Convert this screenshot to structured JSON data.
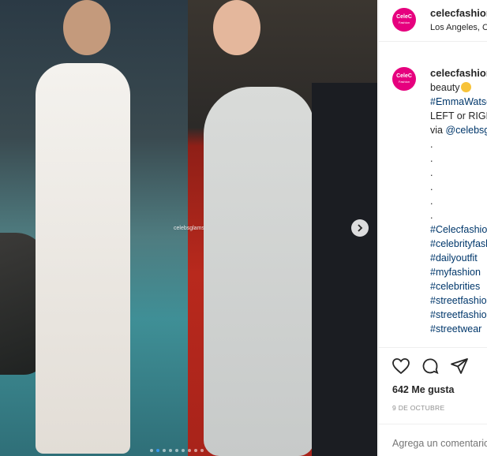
{
  "post": {
    "username": "celecfashion",
    "location": "Los Angeles, California",
    "avatar_text": "CeleC",
    "avatar_sub": "Fashion",
    "watermark": "celebsglams",
    "carousel_dots": 9,
    "active_dot": 1
  },
  "caption": {
    "username": "celecfashion",
    "line1": "beauty",
    "line2": "#EmmaWatson",
    "line3": "LEFT or RIGHT",
    "line4_prefix": "via ",
    "line4_tag": "@celebsglams",
    "dots": [
      ".",
      ".",
      ".",
      ".",
      ".",
      "."
    ],
    "hashtags": [
      "#Celecfashion",
      "#celebrityfashion",
      "#dailyoutfit",
      "#myfashion",
      "#celebrities",
      "#streetfashion",
      "#streetfashion",
      "#streetwear"
    ]
  },
  "actions": {
    "like_icon": "heart-icon",
    "comment_icon": "comment-icon",
    "share_icon": "share-icon"
  },
  "likes": "642 Me gusta",
  "date": "9 DE OCTUBRE",
  "comment_placeholder": "Agrega un comentario..."
}
